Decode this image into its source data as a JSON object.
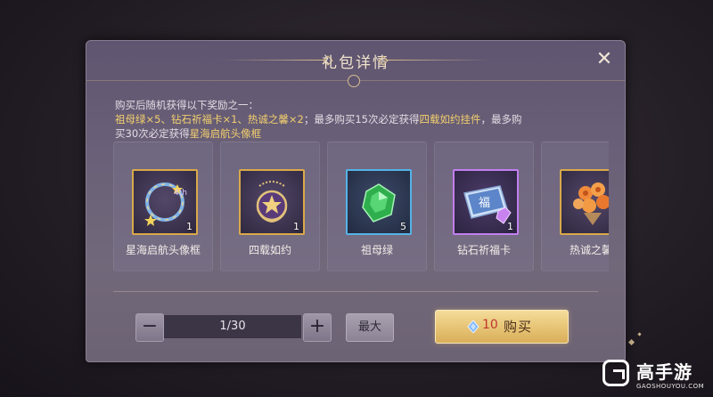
{
  "dialog": {
    "title": "礼包详情",
    "close_label": "✕",
    "description": {
      "line1": "购买后随机获得以下奖励之一：",
      "line2_gold_a": "祖母绿×5、钻石祈福卡×1、热诚之馨×2",
      "line2_mid": "；最多购买15次必定获得",
      "line2_gold_b": "四载如约挂件",
      "line2_end": "，最多购",
      "line3_start": "买30次必定获得",
      "line3_gold": "星海启航头像框"
    }
  },
  "rewards": [
    {
      "label": "星海启航头像框",
      "qty": "1",
      "icon": "avatar-frame-icon",
      "rarity": "gold"
    },
    {
      "label": "四载如约",
      "qty": "1",
      "icon": "pendant-icon",
      "rarity": "gold"
    },
    {
      "label": "祖母绿",
      "qty": "5",
      "icon": "emerald-icon",
      "rarity": "blue"
    },
    {
      "label": "钻石祈福卡",
      "qty": "1",
      "icon": "blessing-card-icon",
      "rarity": "purple"
    },
    {
      "label": "热诚之馨",
      "qty": "",
      "icon": "bouquet-icon",
      "rarity": "gold"
    }
  ],
  "purchase": {
    "minus": "−",
    "plus": "+",
    "quantity": "1/30",
    "max_label": "最大",
    "price": "10",
    "buy_label": "购买"
  },
  "watermark": {
    "name": "高手游",
    "domain": "GAOSHOUYOU.COM"
  },
  "colors": {
    "gold_text": "#f2cf6e",
    "gold_border": "#d9a94a",
    "blue_border": "#55b3e5",
    "purple_border": "#c27ff0",
    "price_red": "#c2362e"
  }
}
